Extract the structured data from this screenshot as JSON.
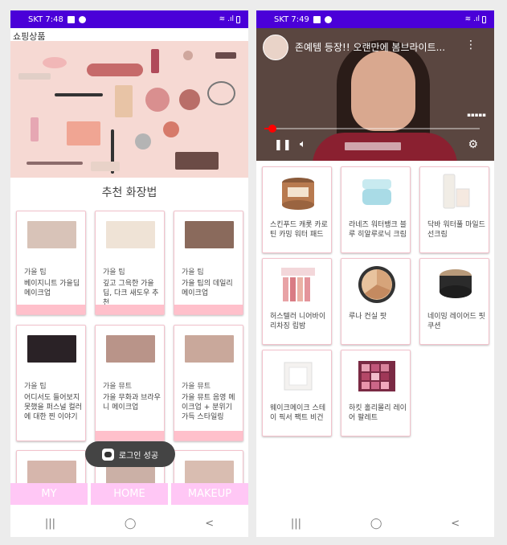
{
  "left": {
    "status": {
      "time": "SKT 7:48"
    },
    "app_title": "쇼핑상품",
    "section_title": "추천 화장법",
    "cards": [
      {
        "category": "가을 팁",
        "title": "베이지니트 가을딥 메이크업",
        "thumb_color": "#d8c3b8"
      },
      {
        "category": "가을 팁",
        "title": "깊고 그윽한 가을 딥, 다크 새도우 추천",
        "thumb_color": "#efe3d6"
      },
      {
        "category": "가을 팁",
        "title": "가을 팁의 데일리 메이크업",
        "thumb_color": "#8a6a5c"
      },
      {
        "category": "가을 팁",
        "title": "어디서도 들어보지 못했을 퍼스널 컬러에 대한 찐 이야기",
        "thumb_color": "#2a2226"
      },
      {
        "category": "가을 뮤트",
        "title": "가을 무화과 브라우니 메이크업",
        "thumb_color": "#b99489"
      },
      {
        "category": "가을 뮤트",
        "title": "가을 뮤트 음영 메이크업 + 분위기 가득 스타일링",
        "thumb_color": "#c9a89b"
      },
      {
        "category": "",
        "title": "",
        "thumb_color": "#d6b6ac"
      },
      {
        "category": "",
        "title": "",
        "thumb_color": "#cbb0a6"
      },
      {
        "category": "",
        "title": "",
        "thumb_color": "#d9bdb1"
      }
    ],
    "toast": "로그인 성공",
    "nav": [
      "MY",
      "HOME",
      "MAKEUP"
    ]
  },
  "right": {
    "status": {
      "time": "SKT 7:49"
    },
    "video": {
      "title": "존예템 등장!! 오랜만에 봄브라이트..."
    },
    "products": [
      {
        "name": "스킨푸드 캐롯 카로틴 카밍 워터 패드",
        "icon": "jar-icon",
        "color": "#b87a4f"
      },
      {
        "name": "라네즈 워터뱅크 블루 히알루로닉 크림",
        "icon": "cream-jar-icon",
        "color": "#a9dbe6"
      },
      {
        "name": "닥바 워터풀 마일드 선크림",
        "icon": "tube-icon",
        "color": "#f1ede6"
      },
      {
        "name": "허스텔러 니어바이 리차징 립밤",
        "icon": "lipbalm-icon",
        "color": "#e8a3a6"
      },
      {
        "name": "루나 컨실 팟",
        "icon": "concealer-icon",
        "color": "#d6a47a"
      },
      {
        "name": "네이밍 레이어드 핏 쿠션",
        "icon": "cushion-icon",
        "color": "#2b2b2b"
      },
      {
        "name": "웨이크메이크 스테이 픽서 팩트 비건",
        "icon": "pact-icon",
        "color": "#f4f2f0"
      },
      {
        "name": "하킷 홀리몰리 레이어 팔레트",
        "icon": "palette-icon",
        "color": "#c0567a"
      }
    ]
  },
  "colors": {
    "statusbar": "#4a00d8",
    "card_accent": "#ffc0cb",
    "nav_button": "#ffc7f5"
  }
}
